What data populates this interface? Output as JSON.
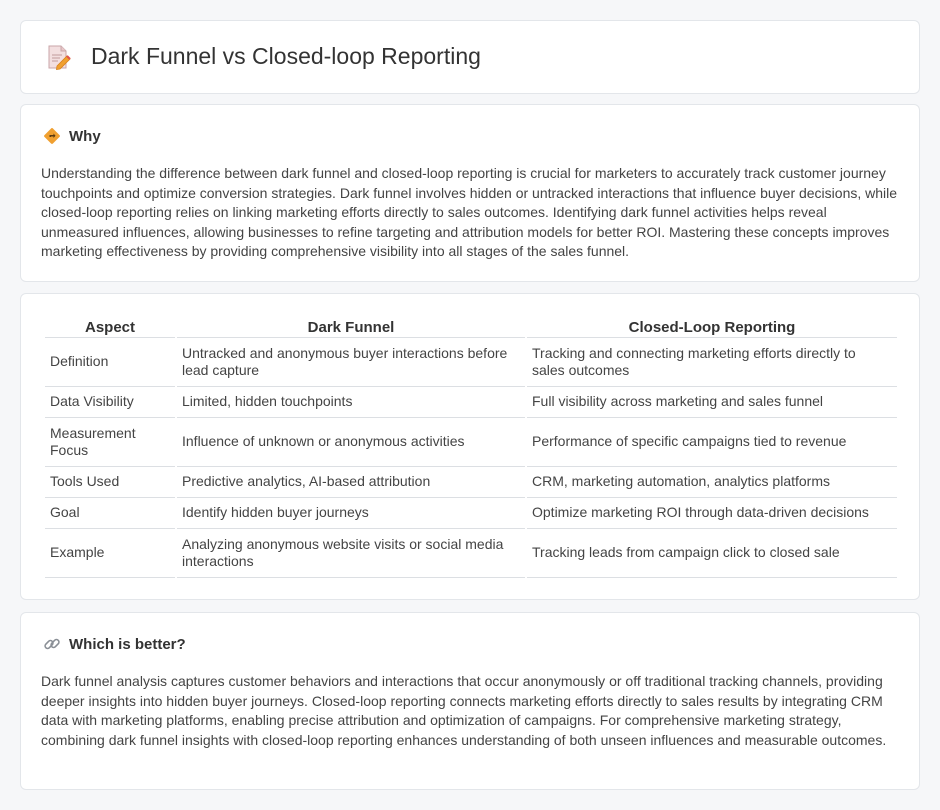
{
  "header": {
    "title": "Dark Funnel vs Closed-loop Reporting",
    "icon": "document-pencil-icon"
  },
  "why": {
    "title": "Why",
    "icon": "diamond-direction-icon",
    "text": "Understanding the difference between dark funnel and closed-loop reporting is crucial for marketers to accurately track customer journey touchpoints and optimize conversion strategies. Dark funnel involves hidden or untracked interactions that influence buyer decisions, while closed-loop reporting relies on linking marketing efforts directly to sales outcomes. Identifying dark funnel activities helps reveal unmeasured influences, allowing businesses to refine targeting and attribution models for better ROI. Mastering these concepts improves marketing effectiveness by providing comprehensive visibility into all stages of the sales funnel."
  },
  "table": {
    "headers": [
      "Aspect",
      "Dark Funnel",
      "Closed-Loop Reporting"
    ],
    "rows": [
      [
        "Definition",
        "Untracked and anonymous buyer interactions before lead capture",
        "Tracking and connecting marketing efforts directly to sales outcomes"
      ],
      [
        "Data Visibility",
        "Limited, hidden touchpoints",
        "Full visibility across marketing and sales funnel"
      ],
      [
        "Measurement Focus",
        "Influence of unknown or anonymous activities",
        "Performance of specific campaigns tied to revenue"
      ],
      [
        "Tools Used",
        "Predictive analytics, AI-based attribution",
        "CRM, marketing automation, analytics platforms"
      ],
      [
        "Goal",
        "Identify hidden buyer journeys",
        "Optimize marketing ROI through data-driven decisions"
      ],
      [
        "Example",
        "Analyzing anonymous website visits or social media interactions",
        "Tracking leads from campaign click to closed sale"
      ]
    ]
  },
  "better": {
    "title": "Which is better?",
    "icon": "link-icon",
    "text": "Dark funnel analysis captures customer behaviors and interactions that occur anonymously or off traditional tracking channels, providing deeper insights into hidden buyer journeys. Closed-loop reporting connects marketing efforts directly to sales results by integrating CRM data with marketing platforms, enabling precise attribution and optimization of campaigns. For comprehensive marketing strategy, combining dark funnel insights with closed-loop reporting enhances understanding of both unseen influences and measurable outcomes."
  },
  "colors": {
    "page_background": "#f6f7f9",
    "card_background": "#ffffff",
    "icon_accent": "#f0a030"
  }
}
